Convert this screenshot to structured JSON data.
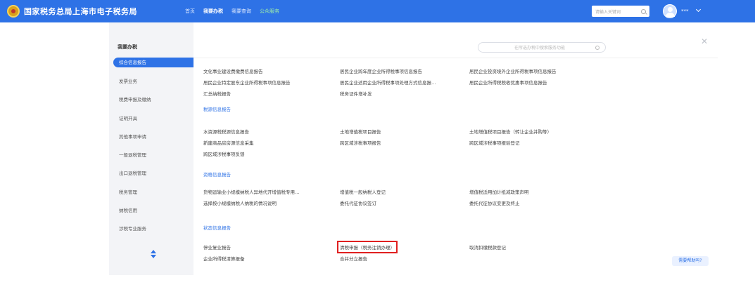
{
  "header": {
    "brand": "国家税务总局上海市电子税务局",
    "nav": [
      "首页",
      "我要办税",
      "我要查询",
      "公众服务"
    ],
    "search_placeholder": "请输入关键词",
    "user_name": "***"
  },
  "sidebar": {
    "title": "我要办税",
    "items": [
      "综合信息报告",
      "发票业务",
      "税费申报及缴纳",
      "证明开具",
      "其他事项申请",
      "一般退税管理",
      "出口退税管理",
      "税务管理",
      "纳税信用",
      "涉税专业服务"
    ]
  },
  "main": {
    "search_placeholder": "在所选办税中搜索服务功能",
    "sections": [
      {
        "title": "",
        "links": [
          "文化事业建设费缴费信息报告",
          "居民企业跨年度企业所得税事项信息报告",
          "居民企业投资境外企业所得税事项信息报告",
          "居民企业特定股东企业所得税事项信息报告",
          "居民企业适用企业所得税事项处理方式信息报…",
          "居民企业所得税税收优惠事项信息报告",
          "汇总纳税报告",
          "税务证件增补发"
        ]
      },
      {
        "title": "税源信息报告",
        "links": [
          "水资源税税源信息报告",
          "土地增值税项目报告",
          "土地增值税项目报告（转让企业并购等）",
          "新建商品房房源信息采集",
          "跨区域涉税事项报告",
          "跨区域涉税事项报验登记",
          "跨区域涉税事项反馈"
        ]
      },
      {
        "title": "资格信息报告",
        "links": [
          "货物运输业小规模纳税人异地代开增值税专用…",
          "增值税一般纳税人登记",
          "增值税适用加计抵减政策声明",
          "选择按小规模纳税人纳税的情况说明",
          "委托代征协议签订",
          "委托代征协议变更及终止"
        ]
      },
      {
        "title": "状态信息报告",
        "links": [
          "停业复业报告",
          "清税申报（税务注销办理）",
          "取消扣缴税款登记",
          "企业所得税清算报备",
          "合并分立报告"
        ]
      }
    ]
  },
  "help_label": "需要帮助吗?",
  "colors": {
    "primary": "#2e72e6",
    "highlight_box": "#e02020"
  }
}
